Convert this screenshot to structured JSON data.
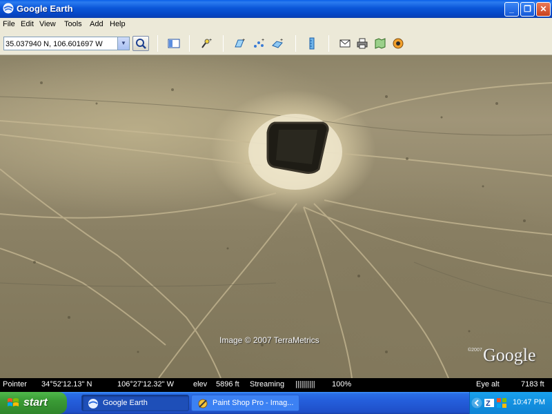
{
  "window": {
    "title": "Google Earth"
  },
  "menu": {
    "items": [
      "File",
      "Edit",
      "View",
      "Tools",
      "Add",
      "Help"
    ]
  },
  "toolbar": {
    "location_value": "35.037940 N, 106.601697 W",
    "icons": [
      "search-icon",
      "sidebar-toggle-icon",
      "placemark-icon",
      "polygon-icon",
      "path-icon",
      "image-overlay-icon",
      "ruler-icon",
      "email-icon",
      "print-icon",
      "maps-icon",
      "sky-icon"
    ]
  },
  "map": {
    "attribution": "Image © 2007 TerraMetrics",
    "logo": "Google",
    "logo_small": "©2007"
  },
  "statusbar": {
    "pointer_label": "Pointer",
    "latitude": "34°52'12.13\" N",
    "longitude": "106°27'12.32\" W",
    "elev_label": "elev",
    "elev_value": "5896 ft",
    "streaming_label": "Streaming",
    "streaming_bars": "||||||||||",
    "streaming_percent": "100%",
    "eye_alt_label": "Eye alt",
    "eye_alt_value": "7183 ft"
  },
  "taskbar": {
    "start_label": "start",
    "tasks": [
      {
        "label": "Google Earth",
        "active": true
      },
      {
        "label": "Paint Shop Pro - Imag...",
        "active": false
      }
    ],
    "clock": "10:47 PM"
  }
}
